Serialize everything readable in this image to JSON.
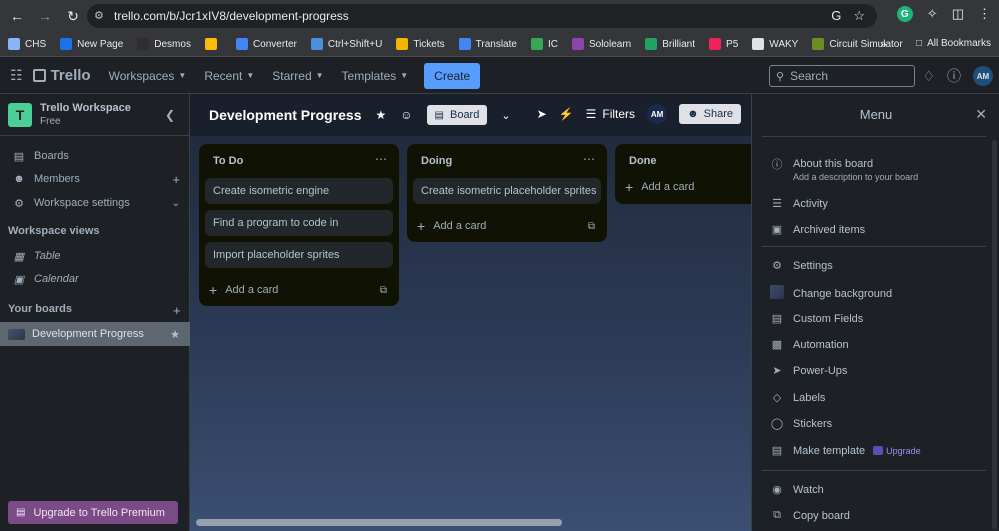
{
  "browser": {
    "url": "trello.com/b/Jcr1xIV8/development-progress",
    "bookmarks": [
      {
        "label": "CHS",
        "color": "#8ab4f8"
      },
      {
        "label": "New Page",
        "color": "#1a73e8"
      },
      {
        "label": "Desmos",
        "color": "#2f2f2f"
      },
      {
        "label": "",
        "color": "#fbbc04"
      },
      {
        "label": "Converter",
        "color": "#4285f4"
      },
      {
        "label": "Ctrl+Shift+U",
        "color": "#4a90d9"
      },
      {
        "label": "Tickets",
        "color": "#f4b400"
      },
      {
        "label": "Translate",
        "color": "#4285f4"
      },
      {
        "label": "IC",
        "color": "#34a853"
      },
      {
        "label": "Sololearn",
        "color": "#8e44ad"
      },
      {
        "label": "Brilliant",
        "color": "#1ea362"
      },
      {
        "label": "P5",
        "color": "#ed225d"
      },
      {
        "label": "WAKY",
        "color": "#dfe1e6"
      },
      {
        "label": "Circuit Simulator",
        "color": "#6b8e23"
      }
    ],
    "all_bookmarks": "All Bookmarks"
  },
  "header": {
    "logo": "Trello",
    "nav": [
      "Workspaces",
      "Recent",
      "Starred",
      "Templates"
    ],
    "create": "Create",
    "search_placeholder": "Search",
    "avatar": "AM"
  },
  "sidebar": {
    "workspace_initial": "T",
    "workspace_name": "Trello Workspace",
    "workspace_plan": "Free",
    "items": [
      {
        "label": "Boards",
        "icon": "boards-icon"
      },
      {
        "label": "Members",
        "icon": "members-icon"
      },
      {
        "label": "Workspace settings",
        "icon": "gear-icon"
      }
    ],
    "views_title": "Workspace views",
    "views": [
      {
        "label": "Table"
      },
      {
        "label": "Calendar"
      }
    ],
    "your_boards_title": "Your boards",
    "boards": [
      {
        "label": "Development Progress"
      }
    ],
    "premium": "Upgrade to Trello Premium"
  },
  "board": {
    "title": "Development Progress",
    "view": "Board",
    "filters": "Filters",
    "avatar": "AM",
    "share": "Share",
    "lists": [
      {
        "title": "To Do",
        "cards": [
          "Create isometric engine",
          "Find a program to code in",
          "Import placeholder sprites"
        ],
        "add": "Add a card"
      },
      {
        "title": "Doing",
        "cards": [
          "Create isometric placeholder sprites"
        ],
        "add": "Add a card"
      },
      {
        "title": "Done",
        "cards": [],
        "add": "Add a card"
      }
    ]
  },
  "menu": {
    "title": "Menu",
    "about_title": "About this board",
    "about_sub": "Add a description to your board",
    "items": [
      "Activity",
      "Archived items",
      "Settings",
      "Change background",
      "Custom Fields",
      "Automation",
      "Power-Ups",
      "Labels",
      "Stickers",
      "Make template",
      "Watch",
      "Copy board"
    ],
    "upgrade": "Upgrade"
  }
}
